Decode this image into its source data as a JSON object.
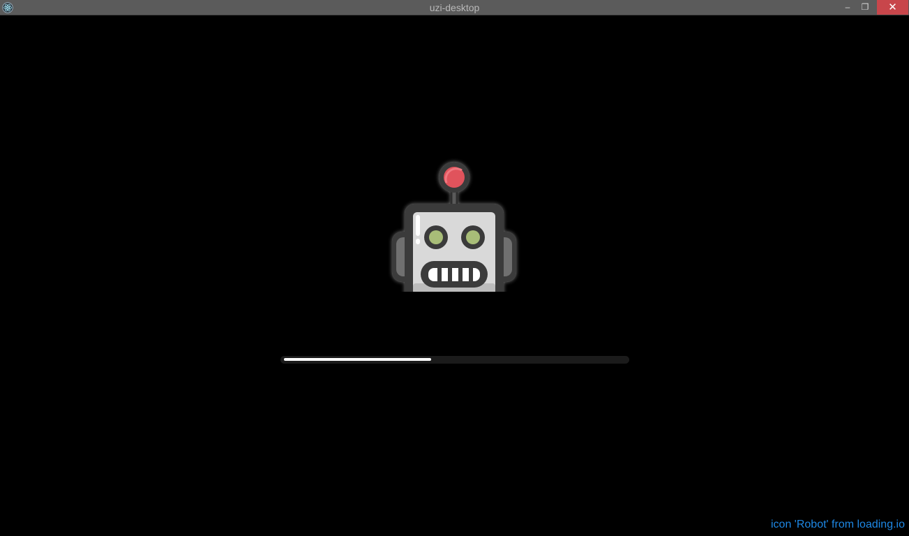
{
  "window": {
    "title": "uzi-desktop",
    "app_icon": "electron-icon",
    "controls": {
      "minimize": "–",
      "maximize": "❐",
      "close": "✕"
    }
  },
  "loader": {
    "icon": "robot-icon",
    "progress_fraction": 0.43
  },
  "credit": {
    "text": "icon 'Robot' from loading.io"
  },
  "colors": {
    "titlebar": "#5b5b5b",
    "close_button": "#c8464b",
    "background": "#000000",
    "progress_fill": "#ffffff",
    "progress_track": "#1b1b1b",
    "credit_link": "#1e88e5",
    "robot_antenna": "#e0535c",
    "robot_eyes": "#a8bd78",
    "robot_face": "#d9d9d9"
  }
}
